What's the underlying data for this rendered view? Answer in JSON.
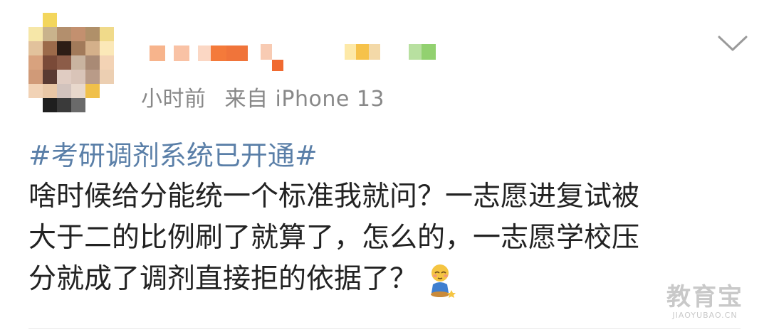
{
  "post": {
    "meta": {
      "time_text": "小时前",
      "source_text": "来自 iPhone 13"
    },
    "topic": "#考研调剂系统已开通#",
    "content_lines": [
      "啥时候给分能统一个标准我就问？一志愿进复试被",
      "大于二的比例刷了就算了，怎么的，一志愿学校压",
      "分就成了调剂直接拒的依据了？"
    ],
    "emoji": "shy-emoji"
  },
  "watermark": {
    "main": "教育宝",
    "sub": "JIAOYUBAO.CN"
  },
  "icons": {
    "more": "chevron-down-icon"
  },
  "colors": {
    "topic": "#5a7fa8",
    "meta": "#888888",
    "text": "#222222"
  }
}
